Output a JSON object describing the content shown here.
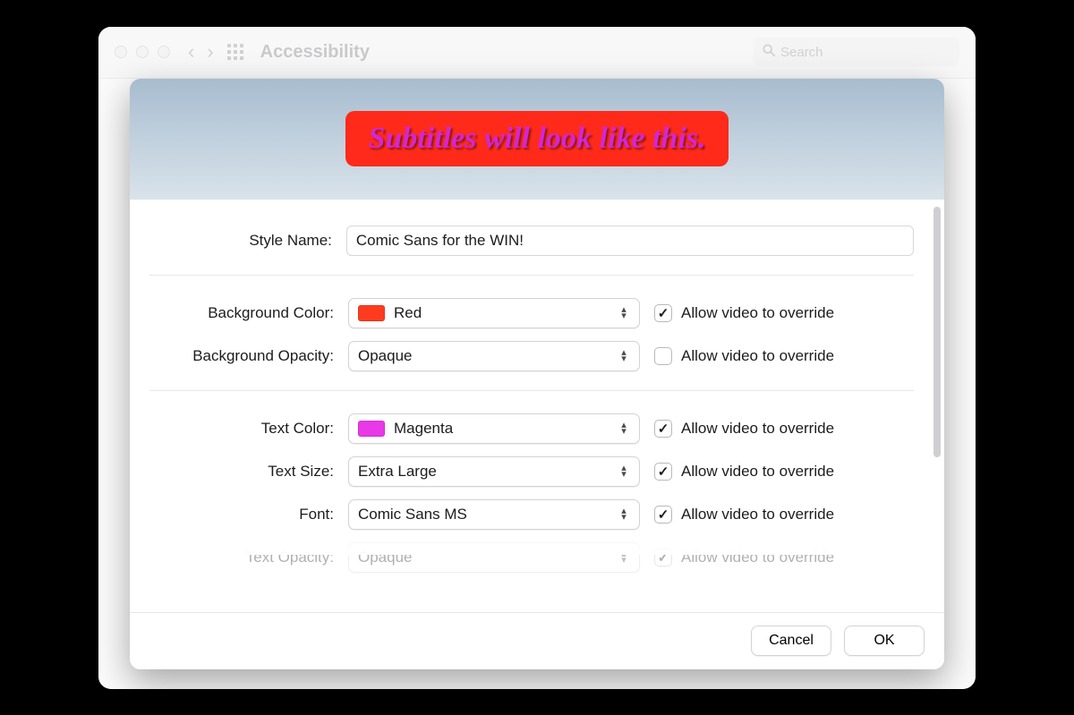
{
  "window": {
    "title": "Accessibility",
    "search_placeholder": "Search"
  },
  "preview": {
    "sample_text": "Subtitles will look like this.",
    "bg_color": "#ff2a1a",
    "text_color": "#d326d3"
  },
  "form": {
    "style_name_label": "Style Name:",
    "style_name_value": "Comic Sans for the WIN!",
    "background_color": {
      "label": "Background Color:",
      "value": "Red",
      "swatch": "#ff3b1f",
      "allow_override": true
    },
    "background_opacity": {
      "label": "Background Opacity:",
      "value": "Opaque",
      "allow_override": false
    },
    "text_color": {
      "label": "Text Color:",
      "value": "Magenta",
      "swatch": "#e838e8",
      "allow_override": true
    },
    "text_size": {
      "label": "Text Size:",
      "value": "Extra Large",
      "allow_override": true
    },
    "font": {
      "label": "Font:",
      "value": "Comic Sans MS",
      "allow_override": true
    },
    "text_opacity": {
      "label": "Text Opacity:",
      "value": "Opaque",
      "allow_override": true
    },
    "override_label": "Allow video to override"
  },
  "buttons": {
    "cancel": "Cancel",
    "ok": "OK"
  }
}
